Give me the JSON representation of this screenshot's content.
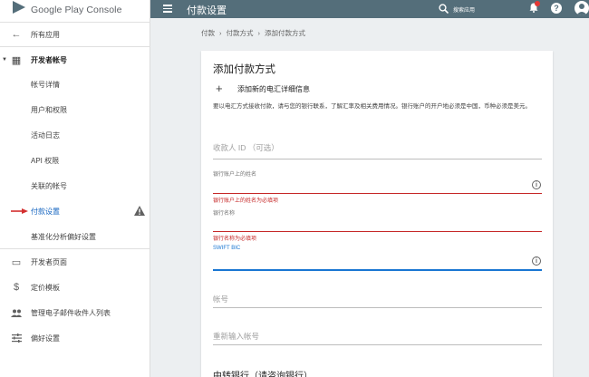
{
  "app": {
    "brand": "Google Play Console"
  },
  "topbar": {
    "title": "付款设置",
    "search_label": "搜索应用"
  },
  "sidebar": {
    "items": [
      {
        "label": "所有应用",
        "icon": "←"
      },
      {
        "label": "开发者帐号",
        "icon": "▦"
      },
      {
        "label": "帐号详情"
      },
      {
        "label": "用户和权限"
      },
      {
        "label": "活动日志"
      },
      {
        "label": "API 权限"
      },
      {
        "label": "关联的帐号"
      },
      {
        "label": "付款设置"
      },
      {
        "label": "基准化分析偏好设置"
      },
      {
        "label": "开发者页面",
        "icon": "▭"
      },
      {
        "label": "定价模板",
        "icon": "$"
      },
      {
        "label": "管理电子邮件收件人列表",
        "icon": "👥"
      },
      {
        "label": "偏好设置",
        "icon": "☰"
      }
    ]
  },
  "breadcrumb": {
    "items": [
      "付款",
      "付款方式",
      "添加付款方式"
    ],
    "sep": "›"
  },
  "card": {
    "title": "添加付款方式",
    "add_label": "添加新的电汇详细信息",
    "description": "要以电汇方式接收付款，请与您的银行联系，了解汇率及相关费用情况。银行账户的开户地必须是中国，币种必须是美元。",
    "fields": {
      "payee_id": "收款人 ID （可选）",
      "account_name_label": "银行账户上的姓名",
      "account_name_error": "银行账户上的姓名为必填项",
      "bank_name_label": "银行名称",
      "bank_name_error": "银行名称为必填项",
      "swift_label": "SWIFT BIC",
      "account_number": "帐号",
      "reenter_account": "重新输入帐号"
    },
    "intermediary_title": "中转银行（请咨询银行）"
  }
}
